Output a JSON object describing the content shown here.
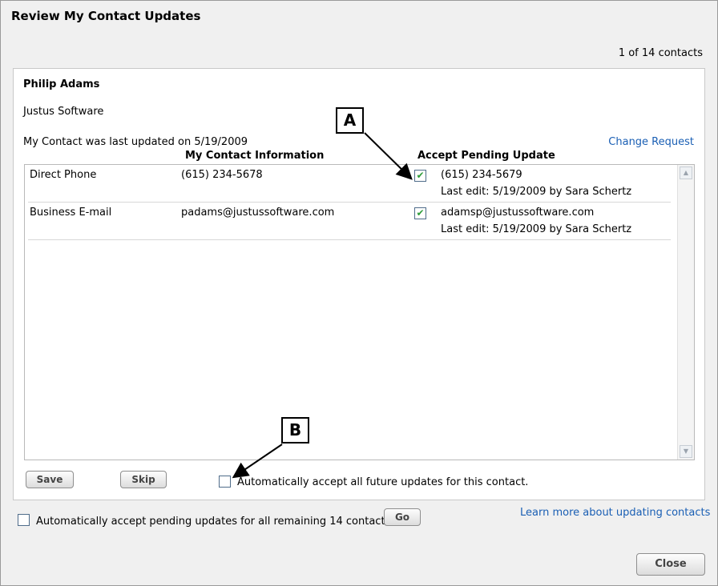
{
  "dialog": {
    "title": "Review My Contact Updates",
    "counter": "1 of 14 contacts"
  },
  "contact": {
    "name": "Philip Adams",
    "company": "Justus Software",
    "last_updated": "My Contact was last updated on 5/19/2009",
    "change_request": "Change Request"
  },
  "columns": {
    "mine": "My Contact Information",
    "accept": "Accept Pending Update"
  },
  "rows": [
    {
      "field": "Direct Phone",
      "current": "(615) 234-5678",
      "accepted": true,
      "pending": "(615) 234-5679",
      "last_edit": "Last edit: 5/19/2009 by Sara Schertz"
    },
    {
      "field": "Business E-mail",
      "current": "padams@justussoftware.com",
      "accepted": true,
      "pending": "adamsp@justussoftware.com",
      "last_edit": "Last edit: 5/19/2009 by Sara Schertz"
    }
  ],
  "actions": {
    "save": "Save",
    "skip": "Skip",
    "auto_accept_contact": "Automatically accept all future updates for this contact.",
    "auto_accept_contact_checked": false
  },
  "footer": {
    "auto_accept_all": "Automatically accept pending updates for all remaining 14 contacts.",
    "auto_accept_all_checked": false,
    "go": "Go",
    "learn_more": "Learn more about updating contacts",
    "close": "Close"
  },
  "callouts": {
    "a": "A",
    "b": "B"
  },
  "icons": {
    "checkbox_checked": "check-icon",
    "scroll_up": "scroll-up-icon",
    "scroll_down": "scroll-down-icon"
  },
  "colors": {
    "link": "#1a5fb4",
    "check": "#2e9d3a"
  }
}
